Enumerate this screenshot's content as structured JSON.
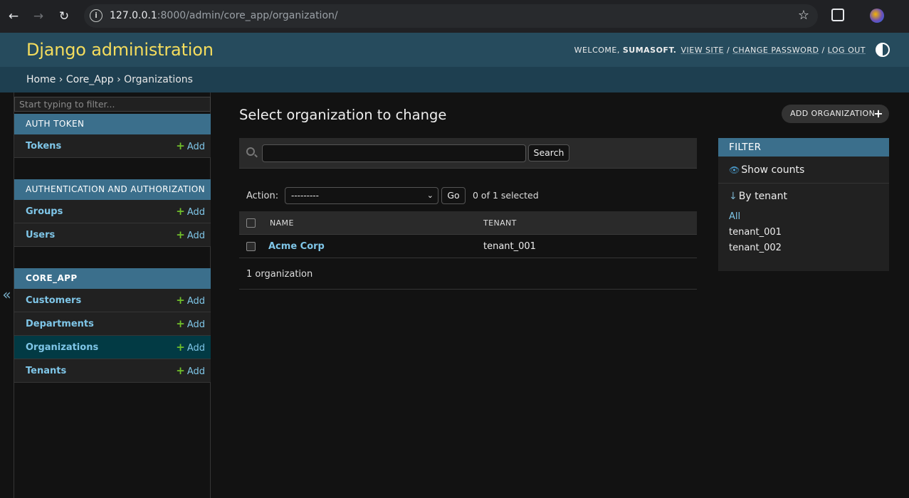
{
  "browser": {
    "url_host": "127.0.0.1",
    "url_path": ":8000/admin/core_app/organization/"
  },
  "header": {
    "branding": "Django administration",
    "welcome": "WELCOME,",
    "username": "SUMASOFT.",
    "view_site": "VIEW SITE",
    "change_password": "CHANGE PASSWORD",
    "log_out": "LOG OUT",
    "separator": "/"
  },
  "breadcrumbs": {
    "home": "Home",
    "app": "Core_App",
    "current": "Organizations",
    "sep": "›"
  },
  "sidebar": {
    "toggle": "«",
    "filter_placeholder": "Start typing to filter...",
    "add_label": "Add",
    "modules": [
      {
        "caption": "AUTH TOKEN",
        "models": [
          "Tokens"
        ]
      },
      {
        "caption": "AUTHENTICATION AND AUTHORIZATION",
        "models": [
          "Groups",
          "Users"
        ]
      },
      {
        "caption": "CORE_APP",
        "models": [
          "Customers",
          "Departments",
          "Organizations",
          "Tenants"
        ]
      }
    ]
  },
  "content": {
    "title": "Select organization to change",
    "add_button": "ADD ORGANIZATION",
    "search_button": "Search",
    "action_label": "Action:",
    "action_selected": "---------",
    "go_button": "Go",
    "selection_count": "0 of 1 selected",
    "columns": [
      "NAME",
      "TENANT"
    ],
    "rows": [
      {
        "name": "Acme Corp",
        "tenant": "tenant_001"
      }
    ],
    "paginator": "1 organization"
  },
  "filter": {
    "title": "FILTER",
    "show_counts": "Show counts",
    "by_tenant": "By tenant",
    "options": [
      "All",
      "tenant_001",
      "tenant_002"
    ],
    "selected": "All"
  }
}
